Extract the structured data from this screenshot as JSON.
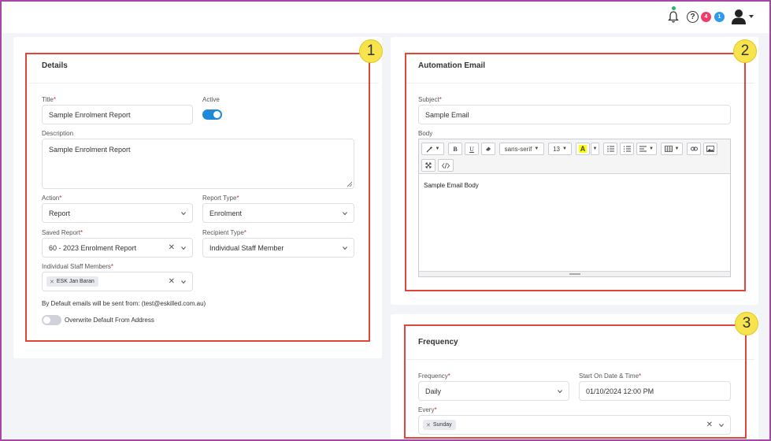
{
  "header": {
    "notification_icon": "bell-icon",
    "help_icon": "question-circle-icon",
    "badge_red": "4",
    "badge_blue": "1",
    "user_icon": "user-avatar-icon"
  },
  "details": {
    "title": "Details",
    "title_label": "Title",
    "title_value": "Sample Enrolment Report",
    "active_label": "Active",
    "active_on": true,
    "description_label": "Description",
    "description_value": "Sample Enrolment Report",
    "action_label": "Action",
    "action_value": "Report",
    "report_type_label": "Report Type",
    "report_type_value": "Enrolment",
    "saved_report_label": "Saved Report",
    "saved_report_value": "60 - 2023 Enrolment Report",
    "recipient_type_label": "Recipient Type",
    "recipient_type_value": "Individual Staff Member",
    "staff_label": "Individual Staff Members",
    "staff_tag": "ESK Jan Baran",
    "default_from_text": "By Default emails will be sent from: (test@eskilled.com.au)",
    "overwrite_label": "Overwrite Default From Address",
    "overwrite_on": false
  },
  "automation": {
    "title": "Automation Email",
    "subject_label": "Subject",
    "subject_value": "Sample Email",
    "body_label": "Body",
    "font_name": "sans-serif",
    "font_size": "13",
    "body_text": "Sample Email Body"
  },
  "frequency": {
    "title": "Frequency",
    "frequency_label": "Frequency",
    "frequency_value": "Daily",
    "start_label": "Start On Date & Time",
    "start_value": "01/10/2024 12:00 PM",
    "every_label": "Every",
    "every_tag": "Sunday"
  },
  "callouts": [
    "1",
    "2",
    "3"
  ],
  "colors": {
    "accent": "#1e88d9",
    "highlight_box": "#e0463d",
    "callout": "#f6e34e",
    "frame": "#a349a4"
  }
}
